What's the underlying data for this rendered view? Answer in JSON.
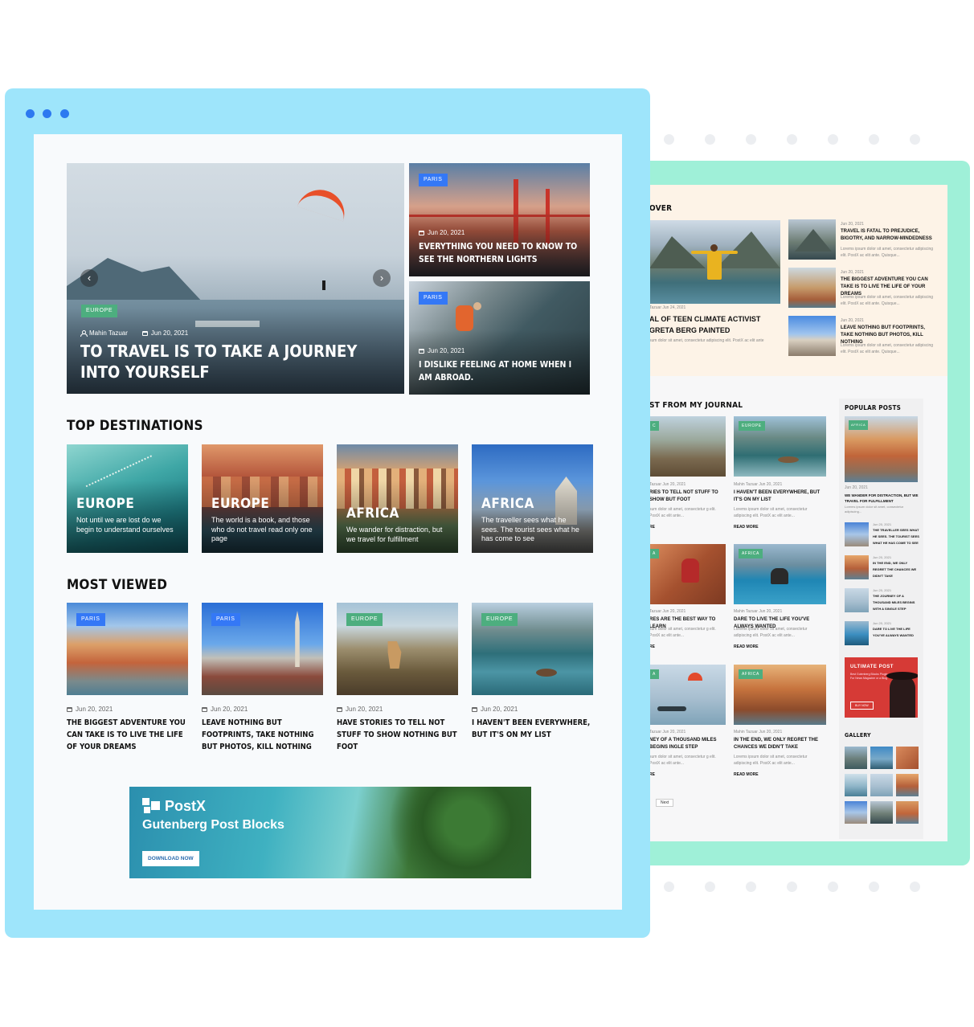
{
  "hero_main": {
    "category": "EUROPE",
    "author": "Mahin Tazuar",
    "date": "Jun 20, 2021",
    "title": "TO TRAVEL IS TO TAKE A JOURNEY INTO YOURSELF",
    "prev_icon": "chevron-left-icon",
    "next_icon": "chevron-right-icon"
  },
  "hero_side": [
    {
      "category": "PARIS",
      "date": "Jun 20, 2021",
      "title": "EVERYTHING YOU NEED TO KNOW TO SEE THE NORTHERN LIGHTS"
    },
    {
      "category": "PARIS",
      "date": "Jun 20, 2021",
      "title": "I DISLIKE FEELING AT HOME WHEN I AM ABROAD."
    }
  ],
  "top_destinations": {
    "heading": "TOP DESTINATIONS",
    "items": [
      {
        "name": "EUROPE",
        "desc": "Not until we are lost do we begin to understand ourselves"
      },
      {
        "name": "EUROPE",
        "desc": "The world is a book, and those who do not travel read only one page"
      },
      {
        "name": "AFRICA",
        "desc": "We wander for distraction, but we travel for fulfillment"
      },
      {
        "name": "AFRICA",
        "desc": "The traveller sees what he sees. The tourist sees what he has come to see"
      }
    ]
  },
  "most_viewed": {
    "heading": "MOST VIEWED",
    "items": [
      {
        "category": "PARIS",
        "date": "Jun 20, 2021",
        "title": "THE BIGGEST ADVENTURE YOU CAN TAKE IS TO LIVE THE LIFE OF YOUR DREAMS"
      },
      {
        "category": "PARIS",
        "date": "Jun 20, 2021",
        "title": "LEAVE NOTHING BUT FOOTPRINTS, TAKE NOTHING BUT PHOTOS, KILL NOTHING"
      },
      {
        "category": "EUROPE",
        "date": "Jun 20, 2021",
        "title": "HAVE STORIES TO TELL NOT STUFF TO SHOW NOTHING BUT FOOT"
      },
      {
        "category": "EUROPE",
        "date": "Jun 20, 2021",
        "title": "I HAVEN'T BEEN EVERYWHERE, BUT IT'S ON MY LIST"
      }
    ]
  },
  "banner": {
    "brand": "PostX",
    "subtitle": "Gutenberg Post Blocks",
    "cta": "DOWNLOAD NOW"
  },
  "back_page": {
    "discover_heading": "OVER",
    "feature_tag": "",
    "feature_meta": "Tazuar    Jun 24, 2021",
    "feature_title": "AL OF TEEN CLIMATE ACTIVIST GRETA BERG PAINTED",
    "feature_excerpt": "sum dolor sit amet, consectetur adipiscing elit. PostX ac elit ante",
    "list": [
      {
        "date": "Jun 20, 2021",
        "title": "TRAVEL IS FATAL TO PREJUDICE, BIGOTRY, AND NARROW-MINDEDNESS",
        "excerpt": "Lorems ipsum dolor sit amet, consectetur adipiscing elit. PostX ac elit ante. Quisque..."
      },
      {
        "date": "Jun 20, 2021",
        "title": "THE BIGGEST ADVENTURE YOU CAN TAKE IS TO LIVE THE LIFE OF YOUR DREAMS",
        "excerpt": "Lorems ipsum dolor sit amet, consectetur adipiscing elit. PostX ac elit ante. Quisque..."
      },
      {
        "date": "Jun 20, 2021",
        "title": "LEAVE NOTHING BUT FOOTPRINTS, TAKE NOTHING BUT PHOTOS, KILL NOTHING",
        "excerpt": "Lorems ipsum dolor sit amet, consectetur adipiscing elit. PostX ac elit ante. Quisque..."
      }
    ],
    "journal_heading": "ST FROM MY JOURNAL",
    "journal": [
      {
        "tag": "C",
        "meta": "Tazuar     Jun 20, 2021",
        "title": "RIES TO TELL NOT STUFF TO SHOW BUT FOOT",
        "excerpt": "sum dolor sit amet, consectetur g elit. PostX ac elit ante...",
        "more": "RE"
      },
      {
        "tag": "EUROPE",
        "meta": "Mahin Tazuar     Jun 20, 2021",
        "title": "I HAVEN'T BEEN EVERYWHERE, BUT IT'S ON MY LIST",
        "excerpt": "Lorems ipsum dolor sit amet, consectetur adipiscing elit. PostX ac elit ante...",
        "more": "READ MORE"
      },
      {
        "tag": "A",
        "meta": "Tazuar     Jun 20, 2021",
        "title": "RES ARE THE BEST WAY TO LEARN",
        "excerpt": "sum dolor sit amet, consectetur g elit. PostX ac elit ante...",
        "more": "RE"
      },
      {
        "tag": "AFRICA",
        "meta": "Mahin Tazuar     Jun 20, 2021",
        "title": "DARE TO LIVE THE LIFE YOU'VE ALWAYS WANTED",
        "excerpt": "Lorems ipsum dolor sit amet, consectetur adipiscing elit. PostX ac elit ante...",
        "more": "READ MORE"
      },
      {
        "tag": "A",
        "meta": "Tazuar     Jun 20, 2021",
        "title": "NEY OF A THOUSAND MILES BEGINS INGLE STEP",
        "excerpt": "sum dolor sit amet, consectetur g elit. PostX ac elit ante...",
        "more": "RE"
      },
      {
        "tag": "AFRICA",
        "meta": "Mahin Tazuar     Jun 20, 2021",
        "title": "IN THE END, WE ONLY REGRET THE CHANCES WE DIDN'T TAKE",
        "excerpt": "Lorems ipsum dolor sit amet, consectetur adipiscing elit. PostX ac elit ante...",
        "more": "READ MORE"
      }
    ],
    "next_label": "Next",
    "popular_heading": "POPULAR POSTS",
    "popular_feature": {
      "tag": "AFRICA",
      "date": "Jun 20, 2021",
      "title": "WE WANDER FOR DISTRACTION, BUT WE TRAVEL FOR FULFILLMENT",
      "excerpt": "Lorems ipsum dolor sit amet, consectetur adipiscing..."
    },
    "popular_list": [
      {
        "date": "Jun 20, 2021",
        "title": "THE TRAVELLER SEES WHAT HE SEES. THE TOURIST SEES WHAT HE HAS COME TO SEE"
      },
      {
        "date": "Jun 20, 2021",
        "title": "IN THE END, WE ONLY REGRET THE CHANCES WE DIDN'T TAKE"
      },
      {
        "date": "Jun 20, 2021",
        "title": "THE JOURNEY OF A THOUSAND MILES BEGINS WITH A SINGLE STEP"
      },
      {
        "date": "Jun 20, 2021",
        "title": "DARE TO LIVE THE LIFE YOU'VE ALWAYS WANTED"
      }
    ],
    "ad": {
      "title": "ULTIMATE POST",
      "text": "Best Gutenberg Blocks Plugin For News Magazine or a Blog",
      "cta": "BUY NOW"
    },
    "gallery_heading": "GALLERY"
  },
  "colors": {
    "front_frame": "#9ee5fb",
    "back_frame": "#9ff0d8",
    "window_dot": "#2d79f0",
    "tag_blue": "#3478f6",
    "tag_green": "#4dae7f"
  }
}
